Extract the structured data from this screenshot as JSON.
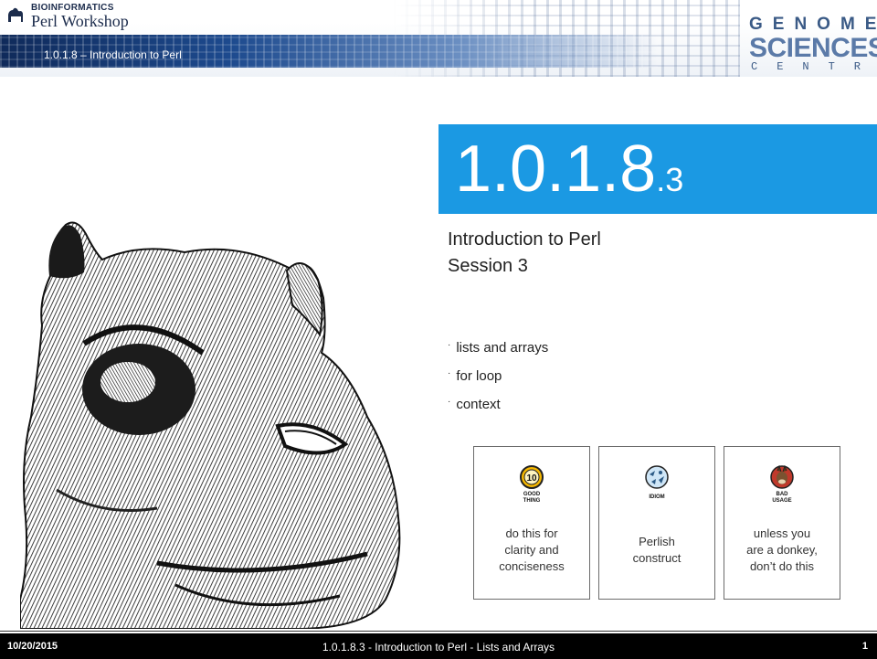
{
  "header": {
    "workshop_org": "BIOINFORMATICS",
    "workshop_name": "Perl Workshop",
    "breadcrumb": "1.0.1.8 – Introduction to Perl",
    "logo_line1": "GENOME",
    "logo_line2": "SCIENCES",
    "logo_line3": "CENTRE"
  },
  "slide": {
    "number_main": "1.0.1.8",
    "number_sub": ".3",
    "title_line1": "Introduction to Perl",
    "title_line2": "Session 3",
    "topics": [
      "lists and arrays",
      "for loop",
      "context"
    ]
  },
  "cards": [
    {
      "icon": "good-thing-10-icon",
      "icon_label_1": "GOOD",
      "icon_label_2": "THING",
      "desc": [
        "do this for",
        "clarity and",
        "conciseness"
      ]
    },
    {
      "icon": "idiom-icon",
      "icon_label_1": "IDIOM",
      "icon_label_2": "",
      "desc": [
        "Perlish",
        "construct"
      ]
    },
    {
      "icon": "bad-usage-donkey-icon",
      "icon_label_1": "BAD",
      "icon_label_2": "USAGE",
      "desc": [
        "unless you",
        "are a donkey,",
        "don’t do this"
      ]
    }
  ],
  "footer": {
    "date": "10/20/2015",
    "title": "1.0.1.8.3 - Introduction to Perl - Lists and Arrays",
    "page": "1"
  },
  "colors": {
    "accent_blue": "#1b99e3",
    "header_navy": "#1d4a8e",
    "footer_bg": "#000000"
  }
}
